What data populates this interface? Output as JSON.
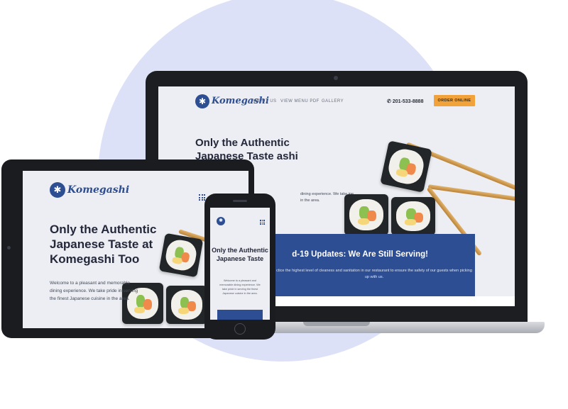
{
  "brand": {
    "name": "Komegashi",
    "logo_symbol": "✱",
    "primary_color": "#2d4e93",
    "accent_color": "#f2a23a",
    "background_circle_color": "#dce1f7"
  },
  "laptop": {
    "nav": {
      "links": [
        "ABOUT US",
        "VIEW MENU PDF",
        "GALLERY"
      ],
      "phone": "201-533-8888",
      "phone_icon": "phone-icon",
      "order_button": "ORDER ONLINE"
    },
    "hero": {
      "title": "Only the Authentic Japanese Taste ashi Too",
      "text": "dining experience. We take ine in the area."
    },
    "banner": {
      "title": "d-19 Updates: We Are Still Serving!",
      "text": "ctice the highest level of cleaness and sanitation in our restaurant to ensure the safety of our guests when picking up with us."
    }
  },
  "tablet": {
    "menu_icon": "grid-menu-icon",
    "hero": {
      "title": "Only the Authentic Japanese Taste at Komegashi Too",
      "text": "Welcome to a pleasant and memorable dining experience. We take pride in serving the finest Japanese cuisine in the area."
    }
  },
  "phone": {
    "menu_icon": "grid-menu-icon",
    "hero": {
      "title": "Only the Authentic Japanese Taste",
      "text": "Welcome to a pleasant and memorable dining experience. We take pride in serving the finest Japanese cuisine in the area."
    }
  }
}
